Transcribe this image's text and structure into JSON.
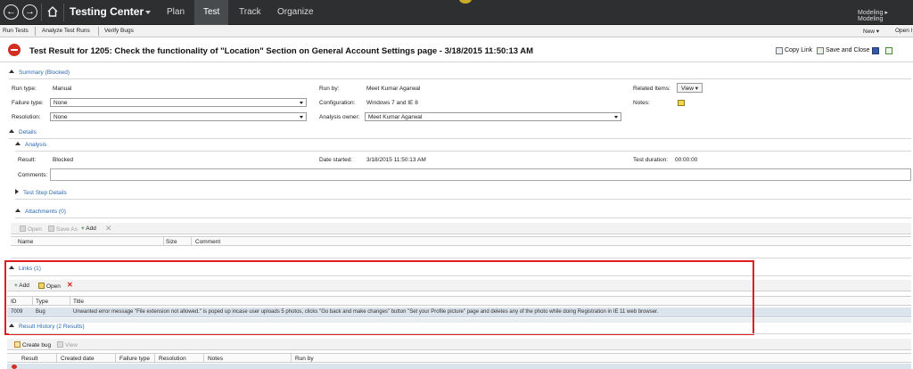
{
  "topbar": {
    "title": "Testing Center",
    "tabs": [
      {
        "label": "Plan"
      },
      {
        "label": "Test"
      },
      {
        "label": "Track"
      },
      {
        "label": "Organize"
      }
    ],
    "breadcrumb": "Modeling ▸ Modeling"
  },
  "subbar": {
    "links": [
      "Run Tests",
      "Analyze Test Runs",
      "Verify Bugs"
    ],
    "new_label": "New ▾",
    "open_label": "Open I"
  },
  "header": {
    "title": "Test Result for 1205: Check the functionality of \"Location\" Section on General Account Settings page - 3/18/2015 11:50:13 AM",
    "copy_link": "Copy Link",
    "save_close": "Save and Close"
  },
  "summary": {
    "heading": "Summary (Blocked)",
    "run_type_label": "Run type:",
    "run_type_value": "Manual",
    "failure_type_label": "Failure type:",
    "failure_type_value": "None",
    "resolution_label": "Resolution:",
    "resolution_value": "None",
    "run_by_label": "Run by:",
    "run_by_value": "Meet Kumar Agarwal",
    "configuration_label": "Configuration:",
    "configuration_value": "Windows 7 and IE 8",
    "analysis_owner_label": "Analysis owner:",
    "analysis_owner_value": "Meet Kumar Agarwal",
    "related_items_label": "Related Items:",
    "view_button": "View ▾",
    "notes_label": "Notes:"
  },
  "details": {
    "heading": "Details",
    "analysis_heading": "Analysis",
    "result_label": "Result:",
    "result_value": "Blocked",
    "date_started_label": "Date started:",
    "date_started_value": "3/18/2015 11:50:13 AM",
    "duration_label": "Test duration:",
    "duration_value": "00:00:00",
    "comments_label": "Comments:",
    "test_step_heading": "Test Step Details"
  },
  "attachments": {
    "heading": "Attachments (0)",
    "toolbar": {
      "open": "Open",
      "save_as": "Save As",
      "add": "Add"
    },
    "columns": [
      "Name",
      "Size",
      "Comment"
    ]
  },
  "links": {
    "heading": "Links (1)",
    "toolbar": {
      "add": "Add",
      "open": "Open"
    },
    "columns": [
      "ID",
      "Type",
      "Title"
    ],
    "rows": [
      {
        "id": "7009",
        "type": "Bug",
        "title": "Unwanted error message \"File extension not allowed.\" is poped up incase user uploads 5 photos, clicks \"Go back and make changes\" button \"Set your Profile picture\" page and deletes any of the photo while doing Registration in IE 11 web browser."
      }
    ]
  },
  "history": {
    "heading": "Result History (2 Results)",
    "toolbar": {
      "create_bug": "Create bug",
      "view": "View"
    },
    "columns": [
      "Result",
      "Created date",
      "Failure type",
      "Resolution",
      "Notes",
      "Run by"
    ]
  },
  "colors": {
    "topbar_bg": "#2d2f31",
    "section_heading": "#2a68b0",
    "highlight_box": "#e01e1e",
    "selected_row": "#dbe3ec"
  }
}
